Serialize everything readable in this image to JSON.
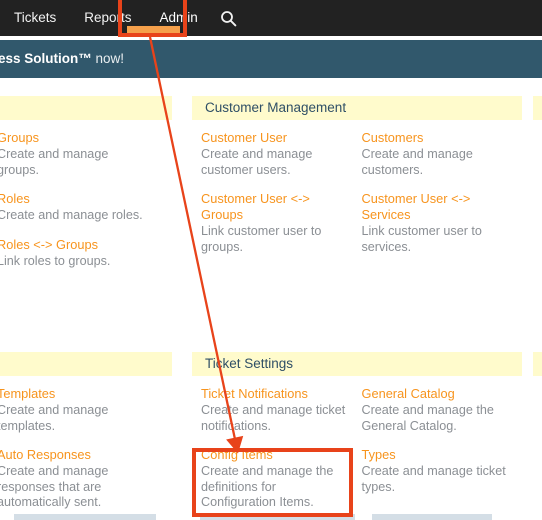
{
  "nav": {
    "items": [
      {
        "label": "Tickets",
        "active": false
      },
      {
        "label": "Reports",
        "active": false
      },
      {
        "label": "Admin",
        "active": true
      }
    ],
    "search_icon": "search-icon",
    "active_item": "Admin"
  },
  "banner": {
    "text_clipped": "ess Solution™ now!",
    "text_bold_part": "ess Solution™",
    "text_tail": " now!"
  },
  "colors": {
    "navbar_bg": "#222222",
    "banner_bg": "#31586c",
    "top_accent": "#e8491f",
    "active_tab_underline": "#f5a04b",
    "block_header_bg": "#fffbcc",
    "block_header_text": "#2f4f66",
    "link": "#f7941e",
    "description": "#8b8f94",
    "annotation": "#e8431a"
  },
  "blocks": [
    {
      "id": "user-management",
      "title": "",
      "columns": [
        {
          "entries": [
            {
              "title": "Groups",
              "desc": "Create and manage groups."
            },
            {
              "title": "Roles",
              "desc": "Create and manage roles."
            },
            {
              "title": "Roles <-> Groups",
              "desc": "Link roles to groups."
            }
          ]
        }
      ]
    },
    {
      "id": "customer-management",
      "title": "Customer Management",
      "columns": [
        {
          "entries": [
            {
              "title": "Customer User",
              "desc": "Create and manage customer users."
            },
            {
              "title": "Customer User <-> Groups",
              "desc": "Link customer user to groups."
            }
          ]
        },
        {
          "entries": [
            {
              "title": "Customers",
              "desc": "Create and manage customers."
            },
            {
              "title": "Customer User <-> Services",
              "desc": "Link customer user to services."
            }
          ]
        }
      ]
    },
    {
      "id": "clipped-top",
      "title": "",
      "columns": []
    },
    {
      "id": "communication",
      "title": "",
      "columns": [
        {
          "entries": [
            {
              "title": "Templates",
              "desc": "Create and manage templates."
            },
            {
              "title": "Auto Responses",
              "desc": "Create and manage responses that are automatically sent."
            }
          ]
        }
      ]
    },
    {
      "id": "ticket-settings",
      "title": "Ticket Settings",
      "columns": [
        {
          "entries": [
            {
              "title": "Ticket Notifications",
              "desc": "Create and manage ticket notifications."
            },
            {
              "title": "Config Items",
              "desc": "Create and manage the definitions for Configuration Items."
            }
          ]
        },
        {
          "entries": [
            {
              "title": "General Catalog",
              "desc": "Create and manage the General Catalog."
            },
            {
              "title": "Types",
              "desc": "Create and manage ticket types."
            }
          ]
        }
      ]
    },
    {
      "id": "clipped-bottom",
      "title": "",
      "columns": []
    }
  ],
  "annotations": {
    "highlight_admin_target": "Admin",
    "highlight_config_target": "Config Items",
    "arrow_from": "Admin",
    "arrow_to": "Config Items"
  }
}
